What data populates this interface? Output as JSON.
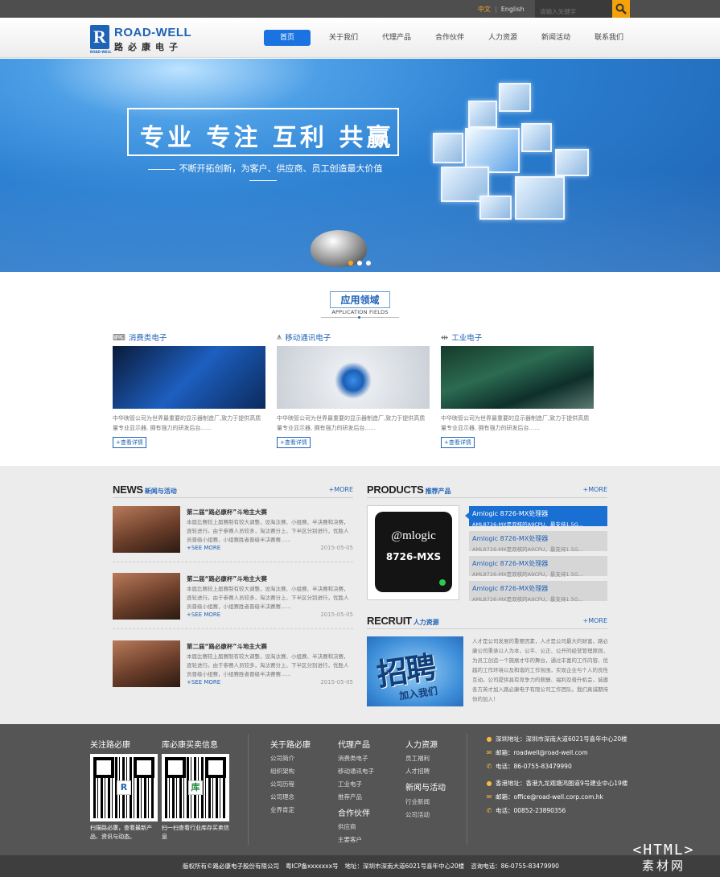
{
  "topbar": {
    "lang_cn": "中文",
    "lang_sep": "|",
    "lang_en": "English",
    "search_placeholder": "请输入关键字",
    "search_icon": "search-icon"
  },
  "logo": {
    "mark": "R",
    "mark_sub": "ROAD-WELL",
    "en": "ROAD-WELL",
    "cn": "路必康电子"
  },
  "nav": [
    {
      "label": "首页",
      "active": true
    },
    {
      "label": "关于我们"
    },
    {
      "label": "代理产品"
    },
    {
      "label": "合作伙伴"
    },
    {
      "label": "人力资源"
    },
    {
      "label": "新闻活动"
    },
    {
      "label": "联系我们"
    }
  ],
  "banner": {
    "title": "专业 专注 互利 共赢",
    "subtitle": "不断开拓创新，为客户、供应商、员工创造最大价值",
    "active_slide": 1,
    "slide_count": 3
  },
  "fields": {
    "title_cn": "应用领域",
    "title_en": "APPLICATION FIELDS",
    "items": [
      {
        "title": "消费类电子",
        "icon": "keyboard-icon",
        "desc": "中华映管公司为世界最重要的显示器制造厂,致力于提供高质量专业显示器, 拥有强力的研发后台......",
        "more": "+查看详情"
      },
      {
        "title": "移动通讯电子",
        "icon": "antenna-icon",
        "desc": "中华映管公司为世界最重要的显示器制造厂,致力于提供高质量专业显示器, 拥有强力的研发后台......",
        "more": "+查看详情"
      },
      {
        "title": "工业电子",
        "icon": "usb-icon",
        "desc": "中华映管公司为世界最重要的显示器制造厂,致力于提供高质量专业显示器, 拥有强力的研发后台......",
        "more": "+查看详情"
      }
    ]
  },
  "news": {
    "title_en": "NEWS",
    "title_cn": "新闻与活动",
    "more": "+MORE",
    "items": [
      {
        "title": "第二届“路必康杯”斗地主大赛",
        "desc": "本届比赛较上届赛制有较大调整，设淘汰赛、小组赛、半决赛和决赛，逐轮进行。由于参赛人员较多，淘汰赛分上、下半区分别进行，优胜人员晋级小组赛，小组赛胜者晋级半决赛赛......",
        "more": "+SEE MORE",
        "date": "2015-05-05"
      },
      {
        "title": "第二届“路必康杯”斗地主大赛",
        "desc": "本届比赛较上届赛制有较大调整，设淘汰赛、小组赛、半决赛和决赛，逐轮进行。由于参赛人员较多，淘汰赛分上、下半区分别进行，优胜人员晋级小组赛，小组赛胜者晋级半决赛赛......",
        "more": "+SEE MORE",
        "date": "2015-05-05"
      },
      {
        "title": "第二届“路必康杯”斗地主大赛",
        "desc": "本届比赛较上届赛制有较大调整，设淘汰赛、小组赛、半决赛和决赛，逐轮进行。由于参赛人员较多，淘汰赛分上、下半区分别进行，优胜人员晋级小组赛，小组赛胜者晋级半决赛赛......",
        "more": "+SEE MORE",
        "date": "2015-05-05"
      }
    ]
  },
  "products": {
    "title_en": "PRODUCTS",
    "title_cn": "推荐产品",
    "more": "+MORE",
    "chip_brand": "@mlogic",
    "chip_model": "8726-MXS",
    "items": [
      {
        "name": "Amlogic 8726-MX处理器",
        "desc": "AML8726-MX是双核的A9CPU，最支持1.5G...",
        "active": true
      },
      {
        "name": "Amlogic 8726-MX处理器",
        "desc": "AML8726-MX是双核的A9CPU，最支持1.5G..."
      },
      {
        "name": "Amlogic 8726-MX处理器",
        "desc": "AML8726-MX是双核的A9CPU，最支持1.5G..."
      },
      {
        "name": "Amlogic 8726-MX处理器",
        "desc": "AML8726-MX是双核的A9CPU，最支持1.5G..."
      }
    ]
  },
  "recruit": {
    "title_en": "RECRUIT",
    "title_cn": "人力资源",
    "more": "+MORE",
    "img_big": "招聘",
    "img_small": "加入我们",
    "text": "人才是公司发展的重要因素，人才是公司最大的财富，路必康公司秉承以人为本，公平、公正、公开的经营管理原则，为员工创造一个施展才华的舞台，通过丰富的工作内容、优越的工作环境以及和谐的工作氛围，实现企业与个人的良性互动。公司提供具有竞争力的薪酬、福利及晋升机会，诚邀各方英才加入路必康电子有限公司工作团队。我们真诚期待你的加入！"
  },
  "footer": {
    "follow_title": "关注路必康",
    "stock_title": "库必康买卖信息",
    "qr1_logo": "R",
    "qr2_logo": "库",
    "qr1_caption": "扫描路必康，查看最新产品、资讯与动态。",
    "qr2_caption": "扫一扫查看行业库存买卖信息",
    "cols": [
      {
        "title": "关于路必康",
        "links": [
          "公司简介",
          "组织架构",
          "公司历程",
          "公司理念",
          "业界肯定"
        ]
      },
      {
        "title": "代理产品",
        "links": [
          "消费类电子",
          "移动通讯电子",
          "工业电子",
          "推荐产品"
        ]
      },
      {
        "title": "合作伙伴",
        "links": [
          "供应商",
          "主要客户"
        ]
      },
      {
        "title": "人力资源",
        "links": [
          "员工福利",
          "人才招聘"
        ]
      },
      {
        "title": "新闻与活动",
        "links": [
          "行业新闻",
          "公司活动"
        ]
      }
    ],
    "contacts": [
      {
        "icon": "location-icon",
        "text": "深圳地址：深圳市深南大道6021号喜年中心20楼"
      },
      {
        "icon": "mail-icon",
        "text": "邮箱：roadwell@road-well.com"
      },
      {
        "icon": "phone-icon",
        "text": "电话：86-0755-83479990"
      },
      {
        "icon": "location-icon",
        "text": "香港地址：香港九龙观塘鸿图道9号建业中心19楼"
      },
      {
        "icon": "mail-icon",
        "text": "邮箱：office@road-well.corp.com.hk"
      },
      {
        "icon": "phone-icon",
        "text": "电话：00852-23890356"
      }
    ]
  },
  "bottom": {
    "copyright": "版权所有©路必康电子股份有限公司",
    "icp": "粤ICP备xxxxxxx号",
    "address": "地址：深圳市深南大道6021号喜年中心20楼",
    "phone": "咨询电话：86-0755-83479990"
  },
  "watermark": {
    "top": "<HTML>",
    "bottom": "素材网"
  }
}
